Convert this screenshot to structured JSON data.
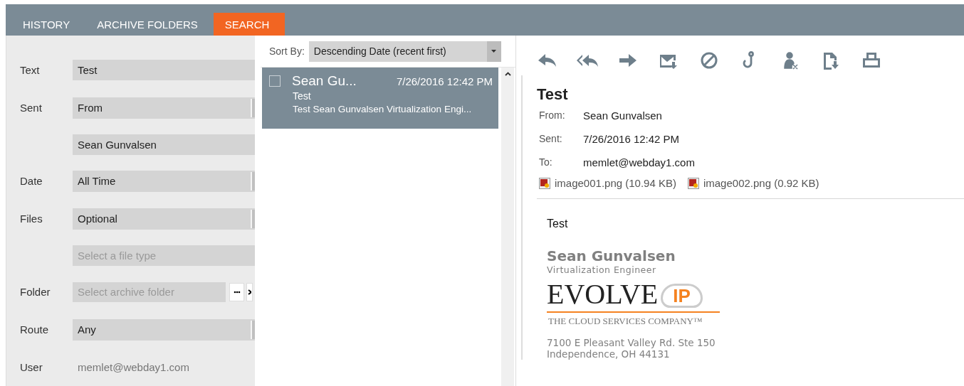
{
  "tabs": [
    {
      "label": "HISTORY",
      "selected": false
    },
    {
      "label": "ARCHIVE FOLDERS",
      "selected": false
    },
    {
      "label": "SEARCH",
      "selected": true
    }
  ],
  "search_form": [
    {
      "label": "Text",
      "kind": "text",
      "value": "Test"
    },
    {
      "label": "Sent",
      "kind": "dropdown",
      "value": "From"
    },
    {
      "kind": "text",
      "value": "Sean Gunvalsen"
    },
    {
      "label": "Date",
      "kind": "dropdown",
      "value": "All Time"
    },
    {
      "label": "Files",
      "kind": "dropdown",
      "value": "Optional"
    },
    {
      "kind": "placeholder",
      "placeholder": "Select a file type"
    },
    {
      "label": "Folder",
      "kind": "folder",
      "placeholder": "Select archive folder"
    },
    {
      "label": "Route",
      "kind": "dropdown",
      "value": "Any"
    },
    {
      "label": "User",
      "kind": "plain",
      "value": "memlet@webday1.com"
    }
  ],
  "sort": {
    "label": "Sort By:",
    "value": "Descending Date (recent first)"
  },
  "messages": [
    {
      "sender": "Sean Gu...",
      "date": "7/26/2016 12:42 PM",
      "subject": "Test",
      "preview": "Test Sean Gunvalsen Virtualization Engi...",
      "selected": true,
      "checked": false
    }
  ],
  "message": {
    "subject": "Test",
    "fields": [
      {
        "label": "From:",
        "value": "Sean Gunvalsen"
      },
      {
        "label": "Sent:",
        "value": "7/26/2016 12:42 PM"
      },
      {
        "label": "To:",
        "value": "memlet@webday1.com"
      }
    ],
    "attachments": [
      "image001.png (10.94 KB)",
      "image002.png (0.92 KB)"
    ],
    "body": "Test",
    "signature": {
      "name": "Sean Gunvalsen",
      "title": "Virtualization Engineer",
      "logo_word": "EVOLVE",
      "logo_badge": "IP",
      "tagline": "THE CLOUD SERVICES COMPANY™",
      "address": [
        "7100 E Pleasant Valley Rd. Ste 150",
        "Independence, OH 44131"
      ]
    }
  }
}
